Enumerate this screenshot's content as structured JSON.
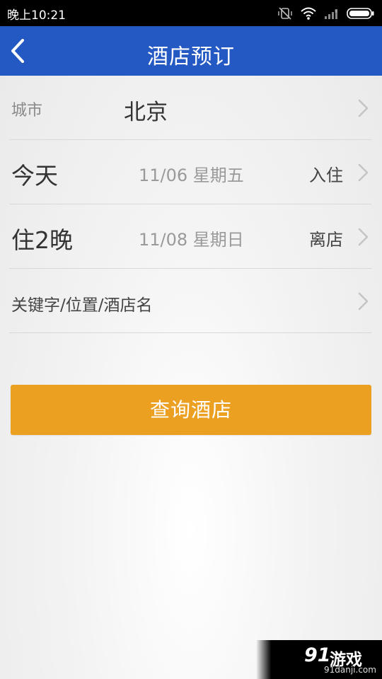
{
  "status_bar": {
    "time": "晚上10:21"
  },
  "header": {
    "title": "酒店预订",
    "back_icon": "chevron-left-icon"
  },
  "form": {
    "city": {
      "label": "城市",
      "value": "北京"
    },
    "checkin": {
      "label": "今天",
      "date": "11/06 星期五",
      "tag": "入住"
    },
    "checkout": {
      "label": "住2晚",
      "date": "11/08 星期日",
      "tag": "离店"
    },
    "keyword": {
      "placeholder": "关键字/位置/酒店名"
    }
  },
  "search_button": {
    "label": "查询酒店",
    "color": "#eca022"
  },
  "watermark": {
    "logo": "91",
    "text": "游戏",
    "url": "91danji.com"
  },
  "colors": {
    "header_bg": "#2459c4",
    "accent": "#eca022"
  }
}
